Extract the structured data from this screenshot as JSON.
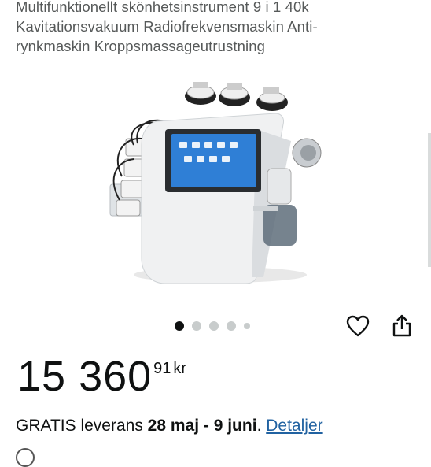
{
  "product": {
    "title_lines": [
      "Multifunktionellt skönhetsinstrument 9 i 1 40k",
      "Kavitationsvakuum Radiofrekvensmaskin Anti-",
      "rynkmaskin Kroppsmassageutrustning"
    ]
  },
  "gallery": {
    "image_icon": "beauty-machine-image",
    "dot_count": 5,
    "active_dot": 0
  },
  "actions": {
    "wishlist_icon": "heart-icon",
    "share_icon": "share-icon"
  },
  "price": {
    "whole": "15 360",
    "fraction": "91",
    "currency": "kr"
  },
  "delivery": {
    "prefix": "GRATIS leverans",
    "dates": "28 maj - 9 juni",
    "period": ".",
    "details_link": "Detaljer"
  },
  "colors": {
    "link": "#2162a1",
    "text": "#0f1111",
    "title": "#565959"
  }
}
